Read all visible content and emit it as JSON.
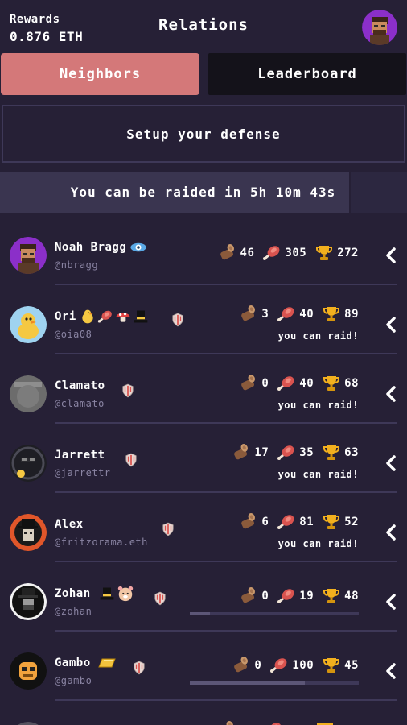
{
  "header": {
    "rewards_label": "Rewards",
    "rewards_value": "0.876 ETH",
    "title": "Relations"
  },
  "tabs": [
    {
      "label": "Neighbors",
      "active": true
    },
    {
      "label": "Leaderboard",
      "active": false
    }
  ],
  "defense_button": "Setup your defense",
  "raid_timer": "You can be raided in 5h 10m 43s",
  "neighbors": [
    {
      "name": "Noah Bragg",
      "handle": "@nbragg",
      "wood": "46",
      "meat": "305",
      "trophy": "272",
      "raid": "",
      "badges": [
        "eye-badge-icon"
      ],
      "shield": false,
      "progress": null
    },
    {
      "name": "Ori",
      "handle": "@oia08",
      "wood": "3",
      "meat": "40",
      "trophy": "89",
      "raid": "you can raid!",
      "badges": [
        "duck-badge-icon",
        "meat-badge-icon",
        "mushroom-badge-icon",
        "tophat-badge-icon"
      ],
      "shield": true,
      "progress": null
    },
    {
      "name": "Clamato",
      "handle": "@clamato",
      "wood": "0",
      "meat": "40",
      "trophy": "68",
      "raid": "you can raid!",
      "badges": [],
      "shield": true,
      "progress": null
    },
    {
      "name": "Jarrett",
      "handle": "@jarrettr",
      "wood": "17",
      "meat": "35",
      "trophy": "63",
      "raid": "you can raid!",
      "badges": [],
      "shield": true,
      "progress": null
    },
    {
      "name": "Alex",
      "handle": "@fritzorama.eth",
      "wood": "6",
      "meat": "81",
      "trophy": "52",
      "raid": "you can raid!",
      "badges": [],
      "shield": true,
      "progress": null
    },
    {
      "name": "Zohan",
      "handle": "@zohan",
      "wood": "0",
      "meat": "19",
      "trophy": "48",
      "raid": "",
      "badges": [
        "tophat-badge-icon",
        "hamster-badge-icon"
      ],
      "shield": true,
      "progress": 0.12
    },
    {
      "name": "Gambo",
      "handle": "@gambo",
      "wood": "0",
      "meat": "100",
      "trophy": "45",
      "raid": "",
      "badges": [
        "gold-bar-badge-icon"
      ],
      "shield": true,
      "progress": 0.68
    }
  ],
  "colors": {
    "background": "#262036",
    "active_tab": "#d47879",
    "inactive_tab": "#14121a",
    "handle_text": "#8a84a3"
  }
}
